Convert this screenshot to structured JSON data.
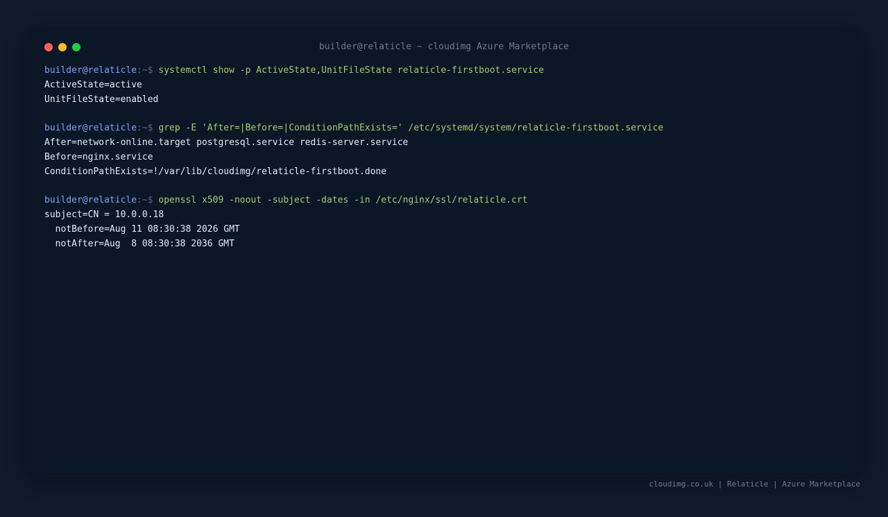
{
  "window": {
    "title": "builder@relaticle ~ cloudimg Azure Marketplace"
  },
  "prompt": {
    "user_host": "builder@relaticle",
    "path": ":~$"
  },
  "blocks": [
    {
      "command": "systemctl show -p ActiveState,UnitFileState relaticle-firstboot.service",
      "output": [
        "ActiveState=active",
        "UnitFileState=enabled"
      ]
    },
    {
      "command": "grep -E 'After=|Before=|ConditionPathExists=' /etc/systemd/system/relaticle-firstboot.service",
      "output": [
        "After=network-online.target postgresql.service redis-server.service",
        "Before=nginx.service",
        "ConditionPathExists=!/var/lib/cloudimg/relaticle-firstboot.done"
      ]
    },
    {
      "command": "openssl x509 -noout -subject -dates -in /etc/nginx/ssl/relaticle.crt",
      "output": [
        "subject=CN = 10.0.0.18",
        "  notBefore=Aug 11 08:30:38 2026 GMT",
        "  notAfter=Aug  8 08:30:38 2036 GMT"
      ]
    }
  ],
  "footer": {
    "text": "cloudimg.co.uk | Relaticle | Azure Marketplace"
  },
  "colors": {
    "background": "#0f1a2a",
    "window": "#0b1627",
    "user": "#7aa2f7",
    "command": "#9ece6a",
    "output": "#e5e9f0"
  }
}
